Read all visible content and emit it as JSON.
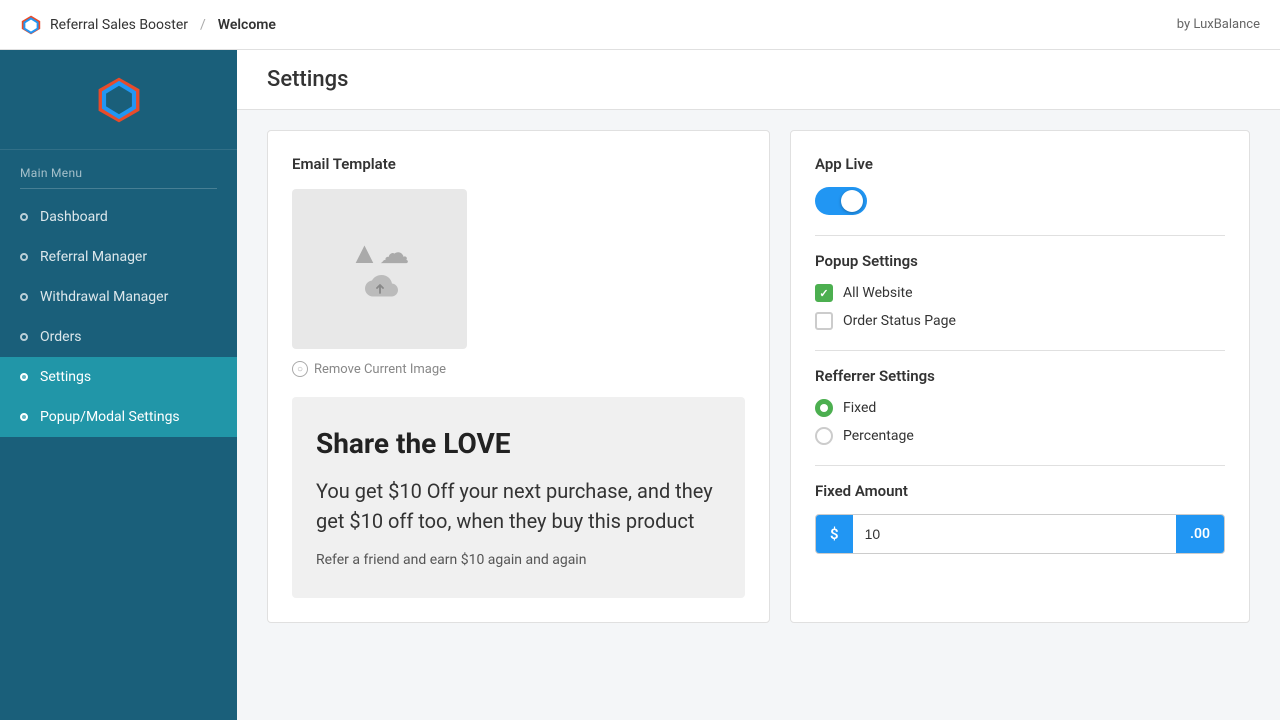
{
  "topbar": {
    "brand": "Referral Sales Booster",
    "separator": "/",
    "page": "Welcome",
    "attribution": "by LuxBalance"
  },
  "sidebar": {
    "menu_label": "Main Menu",
    "items": [
      {
        "id": "dashboard",
        "label": "Dashboard",
        "active": false
      },
      {
        "id": "referral-manager",
        "label": "Referral Manager",
        "active": false
      },
      {
        "id": "withdrawal-manager",
        "label": "Withdrawal Manager",
        "active": false
      },
      {
        "id": "orders",
        "label": "Orders",
        "active": false
      },
      {
        "id": "settings",
        "label": "Settings",
        "active": true
      },
      {
        "id": "popup-modal-settings",
        "label": "Popup/Modal Settings",
        "active": false
      }
    ]
  },
  "page": {
    "title": "Settings"
  },
  "left_card": {
    "section_title": "Email Template",
    "remove_image_label": "Remove Current Image",
    "email_preview": {
      "title": "Share the LOVE",
      "body": "You get $10 Off your next purchase, and they get $10 off too, when they buy this product",
      "footer": "Refer a friend and earn $10 again and again"
    }
  },
  "right_card": {
    "app_live_label": "App Live",
    "popup_settings_label": "Popup Settings",
    "popup_options": [
      {
        "id": "all-website",
        "label": "All Website",
        "checked": true,
        "type": "checkbox"
      },
      {
        "id": "order-status-page",
        "label": "Order Status Page",
        "checked": false,
        "type": "checkbox"
      }
    ],
    "referrer_settings_label": "Refferrer Settings",
    "referrer_options": [
      {
        "id": "fixed",
        "label": "Fixed",
        "checked": true,
        "type": "radio"
      },
      {
        "id": "percentage",
        "label": "Percentage",
        "checked": false,
        "type": "radio"
      }
    ],
    "fixed_amount_label": "Fixed Amount",
    "fixed_amount": {
      "prefix": "$",
      "value": "10",
      "suffix": ".00"
    }
  }
}
